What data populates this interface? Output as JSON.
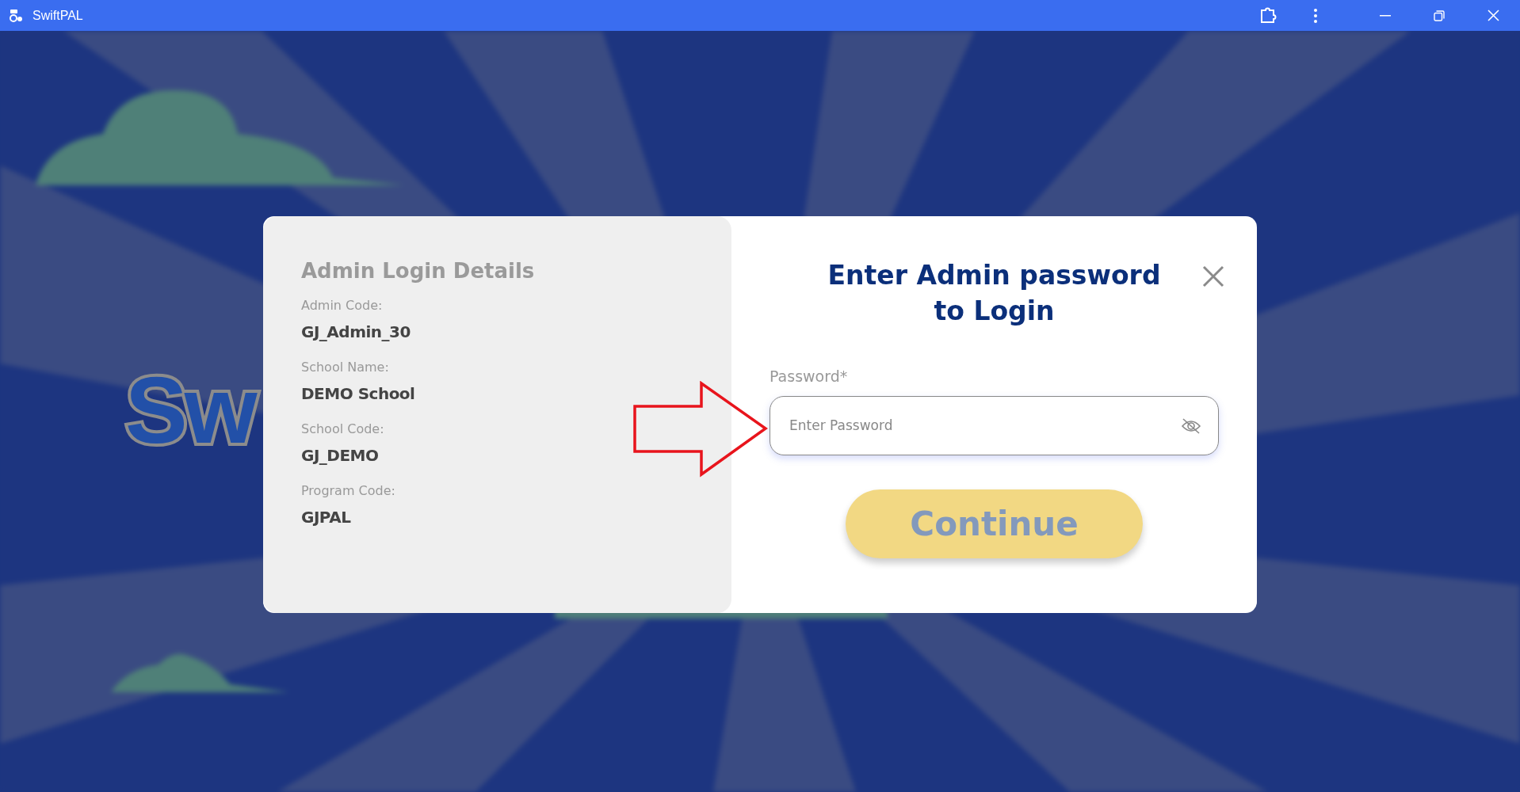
{
  "window": {
    "title": "SwiftPAL"
  },
  "background": {
    "logo_text": "Sw"
  },
  "details_panel": {
    "title": "Admin Login Details",
    "fields": [
      {
        "label": "Admin Code:",
        "value": "GJ_Admin_30"
      },
      {
        "label": "School Name:",
        "value": "DEMO School"
      },
      {
        "label": "School Code:",
        "value": "GJ_DEMO"
      },
      {
        "label": "Program Code:",
        "value": "GJPAL"
      }
    ]
  },
  "login_panel": {
    "heading": "Enter Admin password to Login",
    "password_field": {
      "label": "Password*",
      "placeholder": "Enter Password"
    },
    "continue_button": {
      "label": "Continue",
      "disabled": true
    }
  }
}
